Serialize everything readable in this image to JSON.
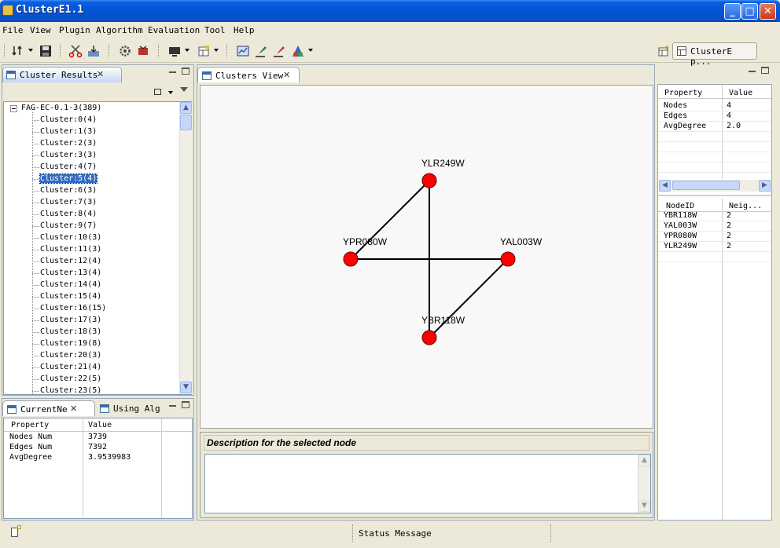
{
  "window": {
    "title": "ClusterE1.1",
    "buttons": {
      "minimize": "_",
      "maximize": "□",
      "close": "✕"
    }
  },
  "menu": [
    "File",
    "View",
    "Plugin",
    "Algorithm",
    "Evaluation",
    "Tool",
    "Help"
  ],
  "toolbar": {
    "icons": [
      "open-file-icon",
      "save-icon",
      "cut-icon",
      "import-icon",
      "settings-icon",
      "plugin-icon",
      "monitor-icon",
      "layout-icon",
      "chart-icon",
      "draw-icon",
      "edit-icon",
      "filter-icon"
    ],
    "perspective_label": "ClusterE p..."
  },
  "cluster_results": {
    "tab_label": "Cluster Results",
    "root": "FAG-EC-0.1-3(389)",
    "items": [
      "Cluster:0(4)",
      "Cluster:1(3)",
      "Cluster:2(3)",
      "Cluster:3(3)",
      "Cluster:4(7)",
      "Cluster:5(4)",
      "Cluster:6(3)",
      "Cluster:7(3)",
      "Cluster:8(4)",
      "Cluster:9(7)",
      "Cluster:10(3)",
      "Cluster:11(3)",
      "Cluster:12(4)",
      "Cluster:13(4)",
      "Cluster:14(4)",
      "Cluster:15(4)",
      "Cluster:16(15)",
      "Cluster:17(3)",
      "Cluster:18(3)",
      "Cluster:19(8)",
      "Cluster:20(3)",
      "Cluster:21(4)",
      "Cluster:22(5)",
      "Cluster:23(5)"
    ],
    "selected_index": 5
  },
  "current_network": {
    "tab_label": "CurrentNe",
    "tab2_label": "Using Alg",
    "headers": [
      "Property",
      "Value"
    ],
    "rows": [
      [
        "Nodes Num",
        "3739"
      ],
      [
        "Edges Num",
        "7392"
      ],
      [
        "AvgDegree",
        "3.9539983"
      ]
    ]
  },
  "clusters_view": {
    "tab_label": "Clusters View",
    "nodes": [
      {
        "id": "YLR249W"
      },
      {
        "id": "YPR080W"
      },
      {
        "id": "YAL003W"
      },
      {
        "id": "YBR118W"
      }
    ],
    "edges": [
      [
        "YLR249W",
        "YPR080W"
      ],
      [
        "YLR249W",
        "YBR118W"
      ],
      [
        "YPR080W",
        "YAL003W"
      ],
      [
        "YAL003W",
        "YBR118W"
      ]
    ],
    "node_color": "#ff0000",
    "description_title": "Description for the selected node"
  },
  "cluster_properties": {
    "headers": [
      "Property",
      "Value"
    ],
    "rows": [
      [
        "Nodes",
        "4"
      ],
      [
        "Edges",
        "4"
      ],
      [
        "AvgDegree",
        "2.0"
      ]
    ]
  },
  "node_table": {
    "headers": [
      "NodeID",
      "Neig..."
    ],
    "rows": [
      [
        "YBR118W",
        "2"
      ],
      [
        "YAL003W",
        "2"
      ],
      [
        "YPR080W",
        "2"
      ],
      [
        "YLR249W",
        "2"
      ]
    ]
  },
  "status": {
    "message": "Status Message"
  }
}
